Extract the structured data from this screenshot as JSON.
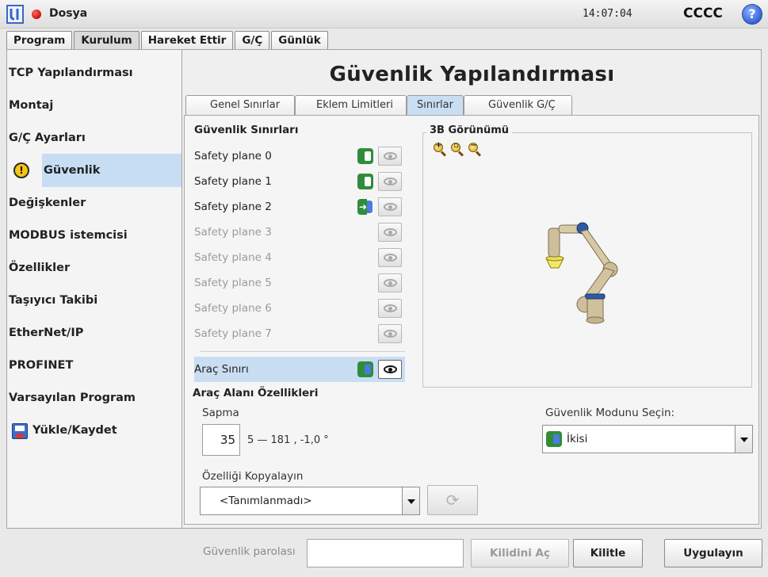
{
  "titlebar": {
    "program_name": "Dosya",
    "clock": "14:07:04",
    "robot_name": "CCCC",
    "help_label": "?"
  },
  "top_tabs": [
    "Program",
    "Kurulum",
    "Hareket Ettir",
    "G/Ç",
    "Günlük"
  ],
  "sidebar": {
    "items": [
      {
        "label": "TCP Yapılandırması"
      },
      {
        "label": "Montaj"
      },
      {
        "label": "G/Ç Ayarları"
      },
      {
        "label": "Güvenlik",
        "icon": "warning-shield-icon",
        "active": true
      },
      {
        "label": "Değişkenler"
      },
      {
        "label": "MODBUS istemcisi"
      },
      {
        "label": "Özellikler"
      },
      {
        "label": "Taşıyıcı Takibi"
      },
      {
        "label": "EtherNet/IP"
      },
      {
        "label": "PROFINET"
      },
      {
        "label": "Varsayılan Program"
      },
      {
        "label": "Yükle/Kaydet",
        "icon": "save-icon"
      }
    ]
  },
  "main": {
    "title": "Güvenlik Yapılandırması",
    "sub_tabs": [
      "Genel Sınırlar",
      "Eklem Limitleri",
      "Sınırlar",
      "Güvenlik G/Ç"
    ],
    "active_sub_tab": "Sınırlar",
    "boundaries_title": "Güvenlik Sınırları",
    "planes": [
      {
        "label": "Safety plane 0",
        "enabled": true,
        "mode": "normal"
      },
      {
        "label": "Safety plane 1",
        "enabled": true,
        "mode": "normal"
      },
      {
        "label": "Safety plane 2",
        "enabled": true,
        "mode": "trigger-reduced"
      },
      {
        "label": "Safety plane 3",
        "enabled": false
      },
      {
        "label": "Safety plane 4",
        "enabled": false
      },
      {
        "label": "Safety plane 5",
        "enabled": false
      },
      {
        "label": "Safety plane 6",
        "enabled": false
      },
      {
        "label": "Safety plane 7",
        "enabled": false
      }
    ],
    "tool_boundary": {
      "label": "Araç Sınırı",
      "mode": "both",
      "visible": true
    },
    "view3d_title": "3B Görünümü",
    "tool_props_title": "Araç Alanı Özellikleri",
    "deviation_label": "Sapma",
    "deviation_value": "35",
    "deviation_range": "5 — 181 , -1,0 °",
    "mode_select_label": "Güvenlik Modunu Seçin:",
    "mode_select_value": "İkisi",
    "copy_label": "Özelliği Kopyalayın",
    "copy_value": "<Tanımlanmadı>"
  },
  "footer": {
    "password_label": "Güvenlik parolası",
    "password_value": "",
    "unlock_label": "Kilidini Aç",
    "lock_label": "Kilitle",
    "apply_label": "Uygulayın"
  },
  "colors": {
    "accent_selection": "#c9def3",
    "mode_green": "#2f8d3a",
    "mode_blue": "#4a7be0"
  }
}
